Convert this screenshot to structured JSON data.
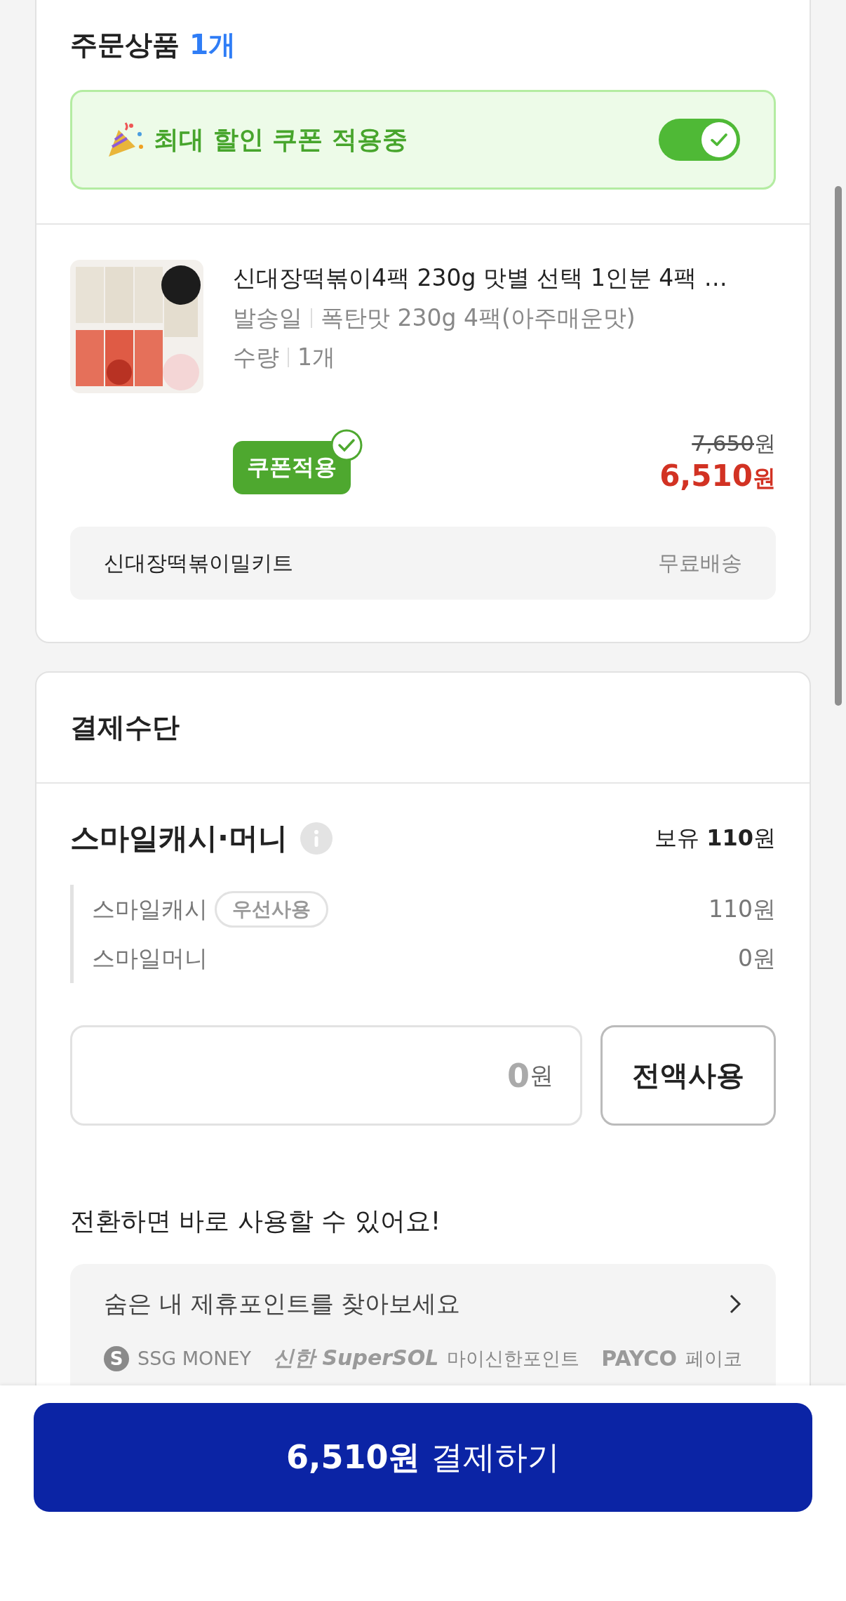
{
  "order_section": {
    "title": "주문상품",
    "count": "1개"
  },
  "coupon_banner": {
    "label": "최대 할인 쿠폰 적용중",
    "on": true
  },
  "product": {
    "kind": "picture",
    "title": "신대장떡볶이4팩 230g 맛별 선택 1인분 4팩 …",
    "options": [
      {
        "label": "발송일",
        "value": "폭탄맛 230g 4팩(아주매운맛)"
      },
      {
        "label": "수량",
        "value": "1개"
      }
    ],
    "coupon_badge": {
      "label": "쿠폰적용",
      "applied": true
    },
    "original_price": "7,650",
    "original_unit": "원",
    "sale_price": "6,510",
    "sale_unit": "원"
  },
  "seller_row": {
    "name": "신대장떡볶이밀키트",
    "shipping": "무료배송"
  },
  "payment_section": {
    "title": "결제수단"
  },
  "smile": {
    "title": "스마일캐시·머니",
    "balance": "보유 **110**원",
    "rows": [
      {
        "name": "스마일캐시",
        "tag": "우선사용",
        "amount": "110원"
      },
      {
        "name": "스마일머니",
        "amount": "0원"
      }
    ],
    "amount_field": {
      "value": "0",
      "unit": "원"
    },
    "use_all_button": "전액사용"
  },
  "convert": {
    "heading": "전환하면 바로 사용할 수 있어요!",
    "link": "숨은 내 제휴포인트를 찾아보세요",
    "partners": [
      {
        "kind": "ssg",
        "mark": "S",
        "name": "SSG MONEY"
      },
      {
        "kind": "shinhan",
        "logo": "신한 SuperSOL",
        "name": "마이신한포인트"
      },
      {
        "kind": "payco",
        "logo": "PAYCO",
        "name": "페이코"
      }
    ]
  },
  "pay_button": "**6,510원** 결제하기"
}
